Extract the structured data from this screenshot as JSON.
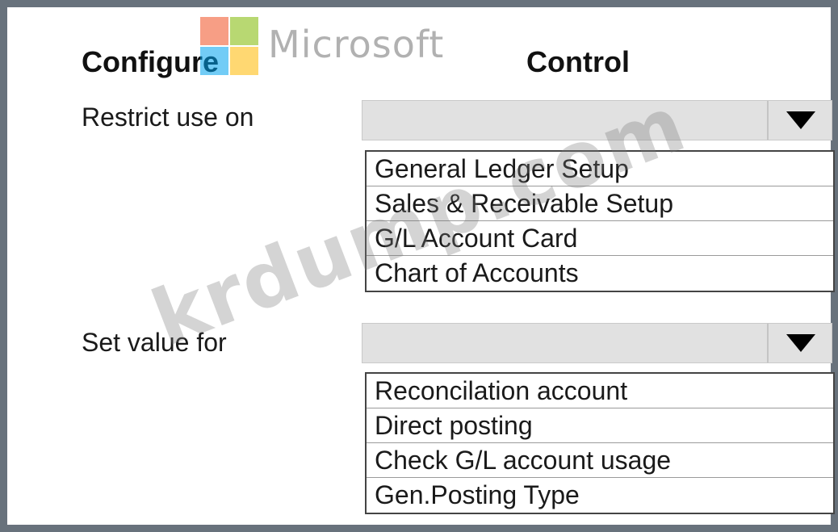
{
  "header": {
    "configure_label": "Configure",
    "control_label": "Control"
  },
  "logo": {
    "text": "Microsoft",
    "colors": [
      "#f25022",
      "#7fba00",
      "#00a4ef",
      "#ffb900"
    ]
  },
  "watermark": {
    "text": "krdump.com"
  },
  "rows": [
    {
      "label": "Restrict use on",
      "selected": "",
      "options": [
        "General Ledger Setup",
        "Sales & Receivable Setup",
        "G/L Account Card",
        "Chart of Accounts"
      ]
    },
    {
      "label": "Set value for",
      "selected": "",
      "options": [
        "Reconcilation account",
        "Direct posting",
        "Check G/L account usage",
        "Gen.Posting Type"
      ]
    }
  ],
  "icons": {
    "dropdown": "chevron-down-icon"
  },
  "colors": {
    "frame": "#68727c",
    "dropdown_bg": "#e1e1e1"
  }
}
